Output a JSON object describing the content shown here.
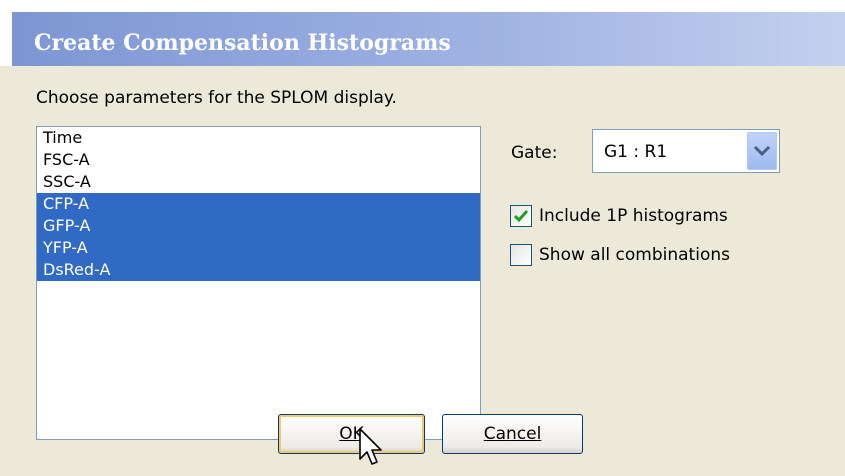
{
  "window": {
    "title": "Create Compensation Histograms"
  },
  "prompt": "Choose parameters for the SPLOM display.",
  "parameters": {
    "items": [
      {
        "label": "Time",
        "selected": false
      },
      {
        "label": "FSC-A",
        "selected": false
      },
      {
        "label": "SSC-A",
        "selected": false
      },
      {
        "label": "CFP-A",
        "selected": true
      },
      {
        "label": "GFP-A",
        "selected": true
      },
      {
        "label": "YFP-A",
        "selected": true
      },
      {
        "label": "DsRed-A",
        "selected": true
      }
    ]
  },
  "gate": {
    "label": "Gate:",
    "value": "G1 : R1"
  },
  "options": {
    "include_1p": {
      "label": "Include 1P histograms",
      "checked": true
    },
    "show_all": {
      "label": "Show all combinations",
      "checked": false
    }
  },
  "buttons": {
    "ok": "OK",
    "cancel": "Cancel"
  },
  "colors": {
    "selection": "#316ac5",
    "title_gradient_start": "#7d96d3",
    "dialog_bg": "#ece9d8"
  },
  "icons": {
    "dropdown": "chevron-down-icon",
    "check": "checkmark-icon",
    "cursor": "mouse-pointer-icon"
  }
}
